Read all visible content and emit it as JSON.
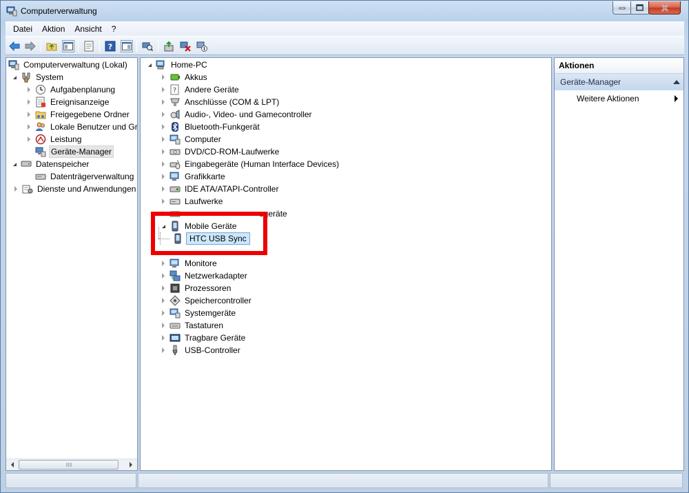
{
  "window": {
    "title": "Computerverwaltung"
  },
  "menu": [
    "Datei",
    "Aktion",
    "Ansicht",
    "?"
  ],
  "left_tree": {
    "root": "Computerverwaltung (Lokal)",
    "system": "System",
    "system_items": [
      "Aufgabenplanung",
      "Ereignisanzeige",
      "Freigegebene Ordner",
      "Lokale Benutzer und Gr",
      "Leistung",
      "Geräte-Manager"
    ],
    "storage": "Datenspeicher",
    "storage_items": [
      "Datenträgerverwaltung"
    ],
    "services": "Dienste und Anwendungen"
  },
  "device_tree": {
    "root": "Home-PC",
    "categories": [
      "Akkus",
      "Andere Geräte",
      "Anschlüsse (COM & LPT)",
      "Audio-, Video- und Gamecontroller",
      "Bluetooth-Funkgerät",
      "Computer",
      "DVD/CD-ROM-Laufwerke",
      "Eingabegeräte (Human Interface Devices)",
      "Grafikkarte",
      "IDE ATA/ATAPI-Controller",
      "Laufwerke",
      "egeräte",
      "Mobile Geräte"
    ],
    "mobile_child": "HTC USB Sync",
    "categories_after": [
      "Monitore",
      "Netzwerkadapter",
      "Prozessoren",
      "Speichercontroller",
      "Systemgeräte",
      "Tastaturen",
      "Tragbare Geräte",
      "USB-Controller"
    ]
  },
  "actions": {
    "header": "Aktionen",
    "section": "Geräte-Manager",
    "more": "Weitere Aktionen"
  },
  "colors": {
    "highlight": "#ee0000",
    "selection": "#cce8ff"
  }
}
